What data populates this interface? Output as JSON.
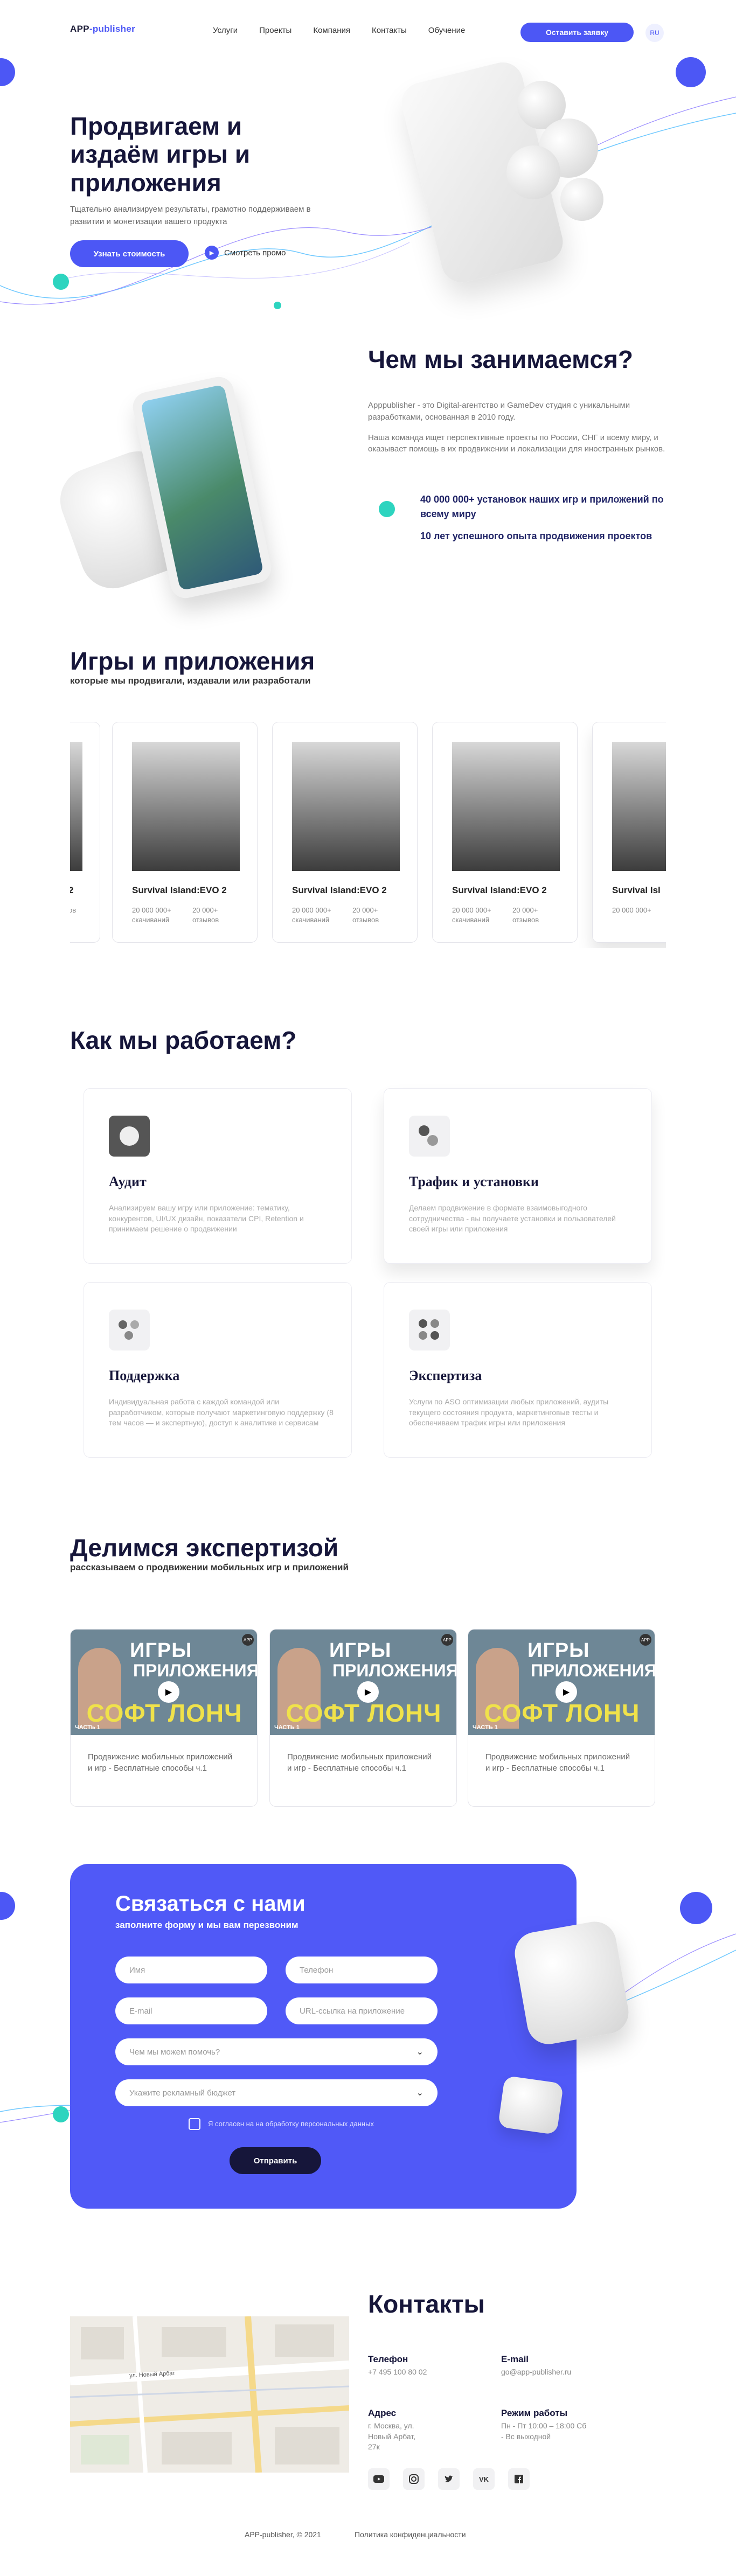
{
  "header": {
    "logo_main": "APP",
    "logo_accent": "-publisher",
    "nav": [
      "Услуги",
      "Проекты",
      "Компания",
      "Контакты",
      "Обучение"
    ],
    "cta": "Оставить заявку",
    "lang": "RU"
  },
  "hero": {
    "title": "Продвигаем и издаём игры и приложения",
    "subtitle": "Тщательно анализируем результаты, грамотно поддерживаем в развитии и монетизации вашего продукта",
    "button": "Узнать стоимость",
    "promo_label": "Смотреть промо"
  },
  "about": {
    "title": "Чем мы занимаемся?",
    "p1": "Apppublisher - это Digital-агентство и GameDev студия с уникальными разработками, основанная в 2010 году.",
    "p2": "Наша команда ищет перспективные проекты по России, СНГ и всему миру, и оказывает помощь в их продвижении и локализации для иностранных рынков.",
    "stat1": "40 000 000+ установок наших игр и приложений по всему миру",
    "stat2": "10 лет успешного опыта продвижения проектов"
  },
  "games": {
    "title": "Игры и приложения",
    "subtitle": "которые мы продвигали, издавали или разработали",
    "items": [
      {
        "name": "Survival Island:EVO 2",
        "downloads": "20 000 000+ скачиваний",
        "reviews": "20 000+ отзывов"
      },
      {
        "name": "Survival Island:EVO 2",
        "downloads": "20 000 000+ скачиваний",
        "reviews": "20 000+ отзывов"
      },
      {
        "name": "Survival Island:EVO 2",
        "downloads": "20 000 000+ скачиваний",
        "reviews": "20 000+ отзывов"
      },
      {
        "name": "Survival Island:EVO 2",
        "downloads": "20 000 000+ скачиваний",
        "reviews": "20 000+ отзывов"
      },
      {
        "name": "Survival Isl",
        "downloads": "20 000 000+",
        "reviews": ""
      }
    ],
    "partial_first": {
      "name": "2",
      "downloads": "ов",
      "reviews": "в"
    }
  },
  "work": {
    "title": "Как мы работаем?",
    "cards": [
      {
        "title": "Аудит",
        "text": "Анализируем вашу игру или приложение: тематику, конкурентов, UI/UX дизайн, показатели CPI, Retention и принимаем решение о продвижении"
      },
      {
        "title": "Трафик и установки",
        "text": "Делаем продвижение в формате взаимовыгодного сотрудничества - вы получаете установки и пользователей своей игры или приложения"
      },
      {
        "title": "Поддержка",
        "text": "Индивидуальная работа с каждой командой или разработчиком, которые получают маркетинговую поддержку (8 тем часов — и экспертную), доступ к аналитике и сервисам"
      },
      {
        "title": "Экспертиза",
        "text": "Услуги по ASO оптимизации любых приложений, аудиты текущего состояния продукта, маркетинговые тесты и обеспечиваем трафик игры или приложения"
      }
    ]
  },
  "expertise": {
    "title": "Делимся экспертизой",
    "subtitle": "рассказываем о продвижении мобильных игр и приложений",
    "videos": [
      {
        "t1": "ИГРЫ",
        "t2": "ПРИЛОЖЕНИЯ",
        "t3": "СОФТ ЛОНЧ",
        "part": "ЧАСТЬ 1",
        "caption": "Продвижение мобильных приложений и игр - Бесплатные способы ч.1"
      },
      {
        "t1": "ИГРЫ",
        "t2": "ПРИЛОЖЕНИЯ",
        "t3": "СОФТ ЛОНЧ",
        "part": "ЧАСТЬ 1",
        "caption": "Продвижение мобильных приложений и игр - Бесплатные способы ч.1"
      },
      {
        "t1": "ИГРЫ",
        "t2": "ПРИЛОЖЕНИЯ",
        "t3": "СОФТ ЛОНЧ",
        "part": "ЧАСТЬ 1",
        "caption": "Продвижение мобильных приложений и игр - Бесплатные способы ч.1"
      }
    ]
  },
  "form": {
    "title": "Связаться с нами",
    "subtitle": "заполните форму и мы вам перезвоним",
    "name_ph": "Имя",
    "phone_ph": "Телефон",
    "email_ph": "E-mail",
    "url_ph": "URL-ссылка на приложение",
    "help_ph": "Чем мы можем помочь?",
    "budget_ph": "Укажите рекламный бюджет",
    "consent": "Я согласен на на обработку персональных данных",
    "submit": "Отправить"
  },
  "contacts": {
    "title": "Контакты",
    "phone_label": "Телефон",
    "phone": "+7 495 100 80 02",
    "email_label": "E-mail",
    "email": "go@app-publisher.ru",
    "address_label": "Адрес",
    "address": "г. Москва, ул. Новый Арбат, 27к",
    "hours_label": "Режим работы",
    "hours": "Пн - Пт 10:00 – 18:00 Сб - Вс выходной",
    "map_street": "ул. Новый Арбат"
  },
  "footer": {
    "copy": "APP-publisher, © 2021",
    "policy": "Политика конфиденциальности"
  },
  "colors": {
    "accent": "#4c57f5",
    "teal": "#2dd4bf",
    "dark": "#16163a"
  }
}
